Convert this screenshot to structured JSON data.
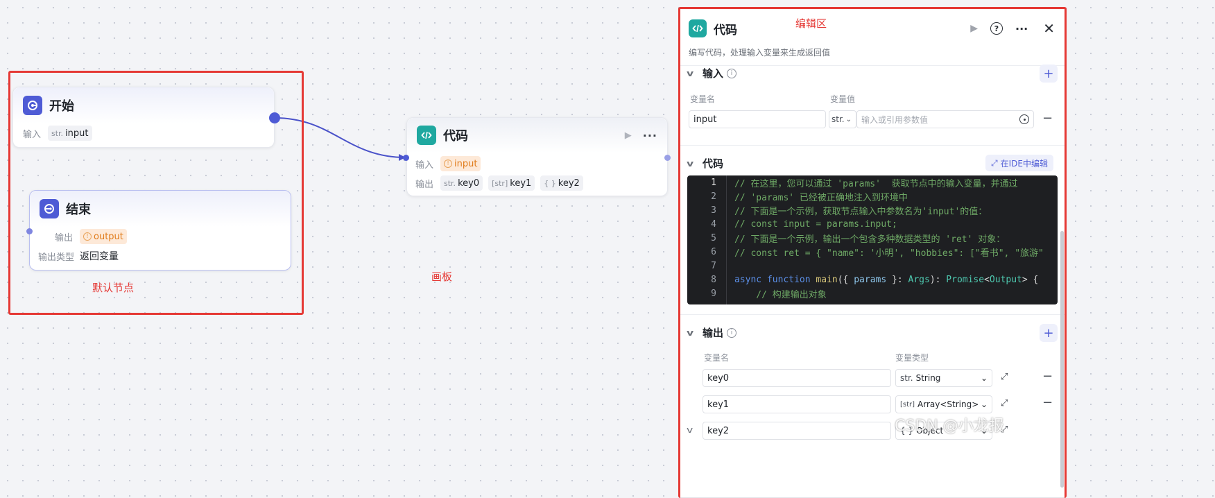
{
  "canvas": {
    "label": "画板",
    "default_nodes_label": "默认节点",
    "edit_area_label": "编辑区",
    "watermark": "CSDN @小龙报"
  },
  "start_node": {
    "title": "开始",
    "input_label": "输入",
    "input_type": "str.",
    "input_name": "input"
  },
  "end_node": {
    "title": "结束",
    "output_label": "输出",
    "output_name": "output",
    "output_type_label": "输出类型",
    "output_type_value": "返回变量"
  },
  "code_node": {
    "title": "代码",
    "input_label": "输入",
    "input_name": "input",
    "output_label": "输出",
    "outputs": [
      {
        "type": "str.",
        "name": "key0"
      },
      {
        "type": "[str]",
        "name": "key1"
      },
      {
        "type": "{ }",
        "name": "key2"
      }
    ]
  },
  "panel": {
    "title": "代码",
    "description": "编写代码，处理输入变量来生成返回值",
    "input_section": {
      "title": "输入",
      "col_name": "变量名",
      "col_value": "变量值",
      "var_name": "input",
      "var_type": "str.",
      "value_placeholder": "输入或引用参数值"
    },
    "code_section": {
      "title": "代码",
      "ide_button": "在IDE中编辑",
      "lines": [
        {
          "n": "1",
          "text": "// 在这里，您可以通过 'params'  获取节点中的输入变量，并通过 ",
          "kind": "comment"
        },
        {
          "n": "2",
          "text": "// 'params' 已经被正确地注入到环境中",
          "kind": "comment"
        },
        {
          "n": "3",
          "text": "// 下面是一个示例，获取节点输入中参数名为'input'的值：",
          "kind": "comment"
        },
        {
          "n": "4",
          "text": "// const input = params.input;",
          "kind": "comment"
        },
        {
          "n": "5",
          "text": "// 下面是一个示例，输出一个包含多种数据类型的 'ret' 对象：",
          "kind": "comment"
        },
        {
          "n": "6",
          "text": "// const ret = { \"name\": '小明', \"hobbies\": [\"看书\", \"旅游\"",
          "kind": "comment"
        },
        {
          "n": "7",
          "text": "",
          "kind": "plain"
        },
        {
          "n": "8",
          "text": "",
          "kind": "main"
        },
        {
          "n": "9",
          "text": "    // 构建输出对象",
          "kind": "comment"
        }
      ],
      "main_tokens": {
        "kw1": "async",
        "kw2": "function",
        "fn": "main",
        "p1": "({ ",
        "param": "params",
        "p2": " }: ",
        "argtype": "Args",
        "p3": "): ",
        "ret": "Promise",
        "p4": "<",
        "out": "Output",
        "p5": "> {"
      }
    },
    "output_section": {
      "title": "输出",
      "col_name": "变量名",
      "col_type": "变量类型",
      "rows": [
        {
          "name": "key0",
          "type_icon": "str.",
          "type": "String"
        },
        {
          "name": "key1",
          "type_icon": "[str]",
          "type": "Array<String>"
        },
        {
          "name": "key2",
          "type_icon": "{ }",
          "type": "Object"
        }
      ]
    }
  },
  "colors": {
    "accent": "#4e5bd5",
    "teal": "#1fa8a0",
    "frame_red": "#e53935",
    "warn_orange": "#e07b1a"
  }
}
